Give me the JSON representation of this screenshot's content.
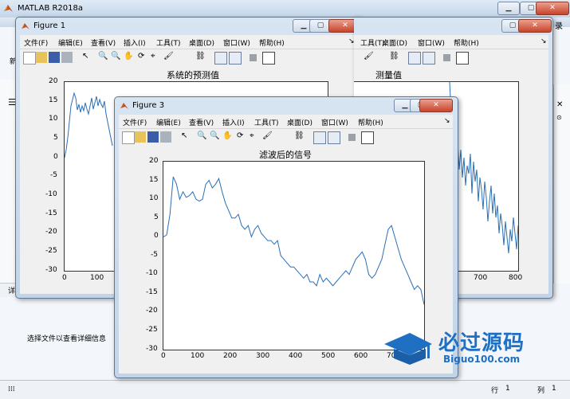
{
  "main": {
    "title": "MATLAB R2018a",
    "detail_prompt": "选择文件以查看详细信息",
    "detail_label": "详",
    "status_row_label": "行",
    "status_row_value": "1",
    "status_col_label": "列",
    "status_col_value": "1",
    "right_partial": "录",
    "left_partial": "新"
  },
  "menu": [
    "文件(F)",
    "编辑(E)",
    "查看(V)",
    "插入(I)",
    "工具(T)",
    "桌面(D)",
    "窗口(W)",
    "帮助(H)"
  ],
  "fig1": {
    "title": "Figure 1",
    "plot_title": "系统的预测值",
    "plot2_title": "测量值",
    "yticks": [
      "20",
      "15",
      "10",
      "5",
      "0",
      "-5",
      "-10",
      "-15",
      "-20",
      "-25",
      "-30"
    ],
    "xticks_left": [
      "0",
      "100"
    ],
    "xticks_right": [
      "700",
      "800"
    ]
  },
  "fig3": {
    "title": "Figure 3",
    "plot_title": "滤波后的信号",
    "yticks": [
      "20",
      "15",
      "10",
      "5",
      "0",
      "-5",
      "-10",
      "-15",
      "-20",
      "-25",
      "-30"
    ],
    "xticks": [
      "0",
      "100",
      "200",
      "300",
      "400",
      "500",
      "600",
      "700"
    ]
  },
  "watermark": {
    "text": "必过源码",
    "url": "Biguo100.com"
  },
  "chart_data": {
    "type": "line",
    "title": "滤波后的信号",
    "xlim": [
      0,
      800
    ],
    "ylim": [
      -30,
      20
    ],
    "x": [
      0,
      10,
      20,
      30,
      40,
      50,
      60,
      70,
      80,
      90,
      100,
      110,
      120,
      130,
      140,
      150,
      160,
      170,
      180,
      190,
      200,
      210,
      220,
      230,
      240,
      250,
      260,
      270,
      280,
      290,
      300,
      310,
      320,
      330,
      340,
      350,
      360,
      370,
      380,
      390,
      400,
      410,
      420,
      430,
      440,
      450,
      460,
      470,
      480,
      490,
      500,
      510,
      520,
      530,
      540,
      550,
      560,
      570,
      580,
      590,
      600,
      610,
      620,
      630,
      640,
      650,
      660,
      670,
      680,
      690,
      700,
      710,
      720,
      730,
      740,
      750,
      760,
      770,
      780,
      790,
      800
    ],
    "series": [
      {
        "values": [
          0,
          0.5,
          6,
          16,
          14,
          10,
          12,
          10.5,
          11,
          12,
          10,
          9.5,
          10,
          14,
          15,
          13,
          14,
          15.5,
          12,
          9,
          7,
          5,
          5,
          6,
          3,
          2,
          3,
          0,
          2,
          3,
          1,
          0,
          -1,
          -1,
          -2,
          -1,
          -5,
          -6,
          -7,
          -8,
          -8,
          -9,
          -10,
          -11,
          -10,
          -12,
          -12,
          -13,
          -10,
          -12,
          -11,
          -12,
          -13,
          -12,
          -11,
          -10,
          -9,
          -10,
          -8,
          -6,
          -5,
          -4,
          -6,
          -10,
          -11,
          -10,
          -8,
          -6,
          -2,
          2,
          3,
          0,
          -3,
          -6,
          -8,
          -10,
          -12,
          -14,
          -13,
          -14,
          -18,
          -22,
          -22,
          -24,
          -25,
          -26,
          -27
        ]
      }
    ]
  }
}
